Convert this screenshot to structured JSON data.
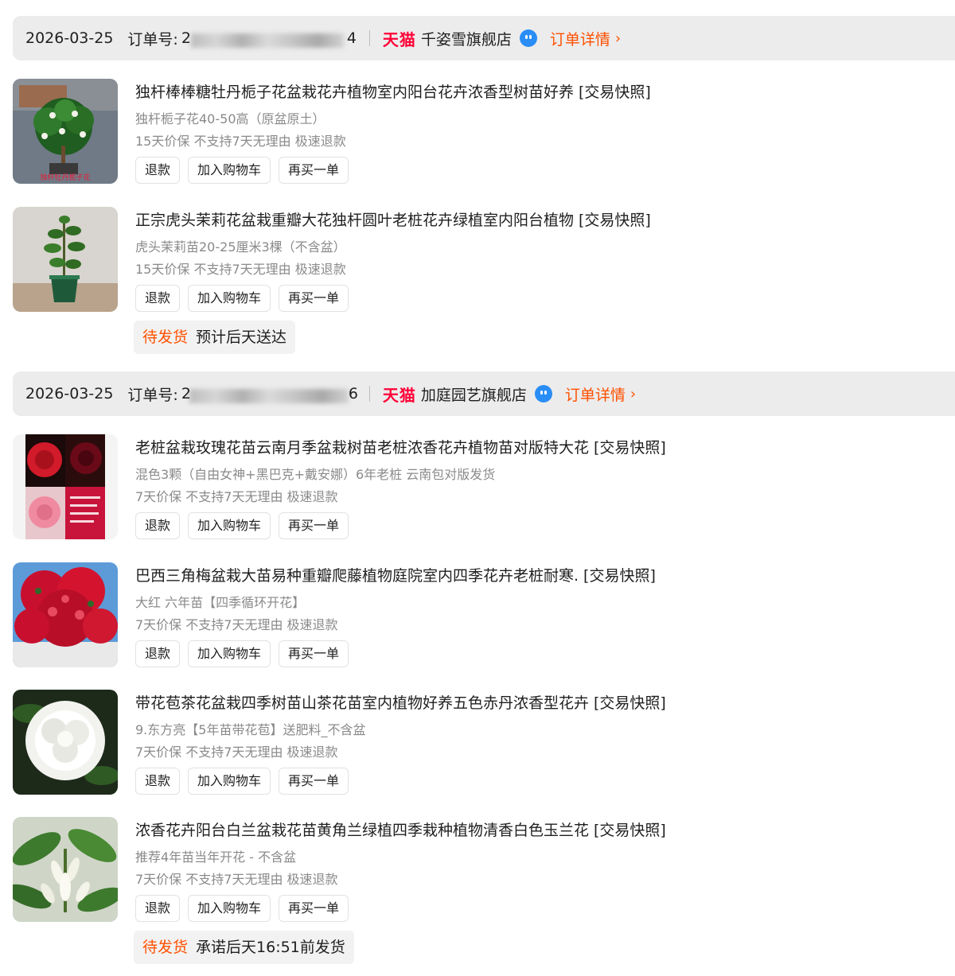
{
  "orders": [
    {
      "date": "2026-03-25",
      "order_no_label": "订单号:",
      "order_no_prefix": "2",
      "order_no_suffix": "4",
      "platform": "天猫",
      "shop": "千姿雪旗舰店",
      "detail": "订单详情",
      "items": [
        {
          "title": "独杆棒棒糖牡丹栀子花盆栽花卉植物室内阳台花卉浓香型树苗好养",
          "snapshot": "[交易快照]",
          "sku": "独杆栀子花40-50高（原盆原土）",
          "service": "15天价保 不支持7天无理由 极速退款",
          "image_caption": "独杆牡丹栀子花"
        },
        {
          "title": "正宗虎头茉莉花盆栽重瓣大花独杆圆叶老桩花卉绿植室内阳台植物",
          "snapshot": "[交易快照]",
          "sku": "虎头茉莉苗20-25厘米3棵（不含盆）",
          "service": "15天价保 不支持7天无理由 极速退款"
        }
      ],
      "status": "待发货",
      "status_note": "预计后天送达"
    },
    {
      "date": "2026-03-25",
      "order_no_label": "订单号:",
      "order_no_prefix": "2",
      "order_no_suffix": "6",
      "platform": "天猫",
      "shop": "加庭园艺旗舰店",
      "detail": "订单详情",
      "items": [
        {
          "title": "老桩盆栽玫瑰花苗云南月季盆栽树苗老桩浓香花卉植物苗对版特大花",
          "snapshot": "[交易快照]",
          "sku": "混色3颗（自由女神+黑巴克+戴安娜）6年老桩 云南包对版发货",
          "service": "7天价保 不支持7天无理由 极速退款"
        },
        {
          "title": "巴西三角梅盆栽大苗易种重瓣爬藤植物庭院室内四季花卉老桩耐寒.",
          "snapshot": "[交易快照]",
          "sku": "大红 六年苗【四季循环开花】",
          "service": "7天价保 不支持7天无理由 极速退款"
        },
        {
          "title": "带花苞茶花盆栽四季树苗山茶花苗室内植物好养五色赤丹浓香型花卉",
          "snapshot": "[交易快照]",
          "sku": "9.东方亮【5年苗带花苞】送肥料_不含盆",
          "service": "7天价保 不支持7天无理由 极速退款"
        },
        {
          "title": "浓香花卉阳台白兰盆栽花苗黄角兰绿植四季栽种植物清香白色玉兰花",
          "snapshot": "[交易快照]",
          "sku": "推荐4年苗当年开花 - 不含盆",
          "service": "7天价保 不支持7天无理由 极速退款"
        }
      ],
      "status": "待发货",
      "status_note": "承诺后天16:51前发货"
    }
  ],
  "buttons": {
    "refund": "退款",
    "add_cart": "加入购物车",
    "buy_again": "再买一单"
  },
  "icons": {
    "chevron": "›",
    "wangwang": "wangwang-chat-icon"
  },
  "colors": {
    "accent": "#ff5000",
    "tmall": "#ff0036",
    "header_bg": "#ececec",
    "muted_text": "#8a8a8a"
  }
}
